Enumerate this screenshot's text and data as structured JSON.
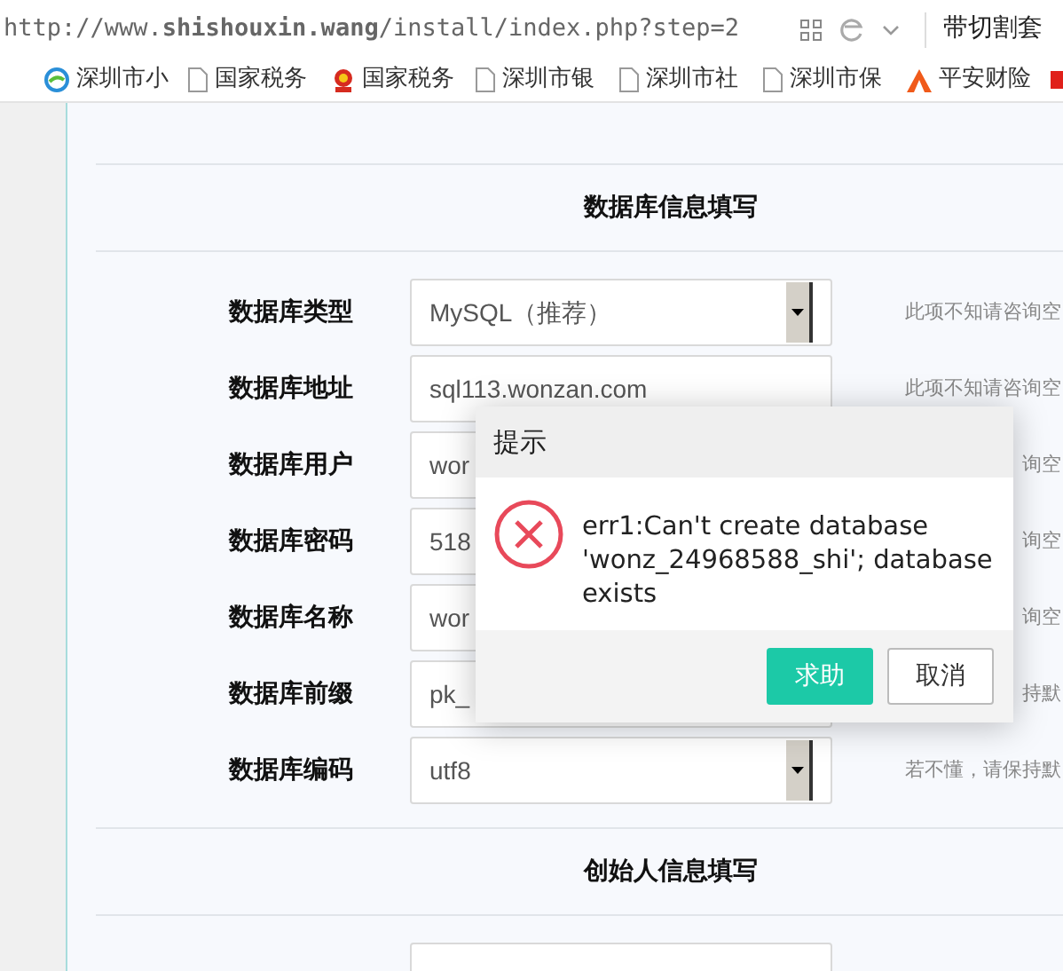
{
  "browser": {
    "address": "http://www.**shishouxin.wang**/install/index.php?step=2",
    "tab_title": "带切割套"
  },
  "bookmarks": [
    {
      "label": "深圳市小",
      "kind": "swirl"
    },
    {
      "label": "国家税务",
      "kind": "page"
    },
    {
      "label": "国家税务",
      "kind": "emblem"
    },
    {
      "label": "深圳市银",
      "kind": "page"
    },
    {
      "label": "深圳市社",
      "kind": "page"
    },
    {
      "label": "深圳市保",
      "kind": "page"
    },
    {
      "label": "平安财险",
      "kind": "triangle"
    }
  ],
  "sections": [
    {
      "title": "数据库信息填写",
      "rows": [
        {
          "label": "数据库类型",
          "kind": "select",
          "value": "MySQL（推荐）",
          "hint": "此项不知请咨询空"
        },
        {
          "label": "数据库地址",
          "kind": "input",
          "value": "sql113.wonzan.com",
          "hint": "此项不知请咨询空"
        },
        {
          "label": "数据库用户",
          "kind": "input",
          "value": "wor",
          "hint": "询空"
        },
        {
          "label": "数据库密码",
          "kind": "input",
          "value": "518",
          "hint": "询空"
        },
        {
          "label": "数据库名称",
          "kind": "input",
          "value": "wor",
          "hint": "询空"
        },
        {
          "label": "数据库前缀",
          "kind": "input",
          "value": "pk_",
          "hint": "持默"
        },
        {
          "label": "数据库编码",
          "kind": "select",
          "value": "utf8",
          "hint": "若不懂，请保持默"
        }
      ]
    },
    {
      "title": "创始人信息填写",
      "rows": [
        {
          "kind": "input"
        }
      ]
    }
  ],
  "dialog": {
    "title": "提示",
    "message": "err1:Can't create database 'wonz_24968588_shi'; database exists",
    "buttons": [
      {
        "label": "求助",
        "kind": "primary"
      },
      {
        "label": "取消",
        "kind": "default"
      }
    ]
  }
}
